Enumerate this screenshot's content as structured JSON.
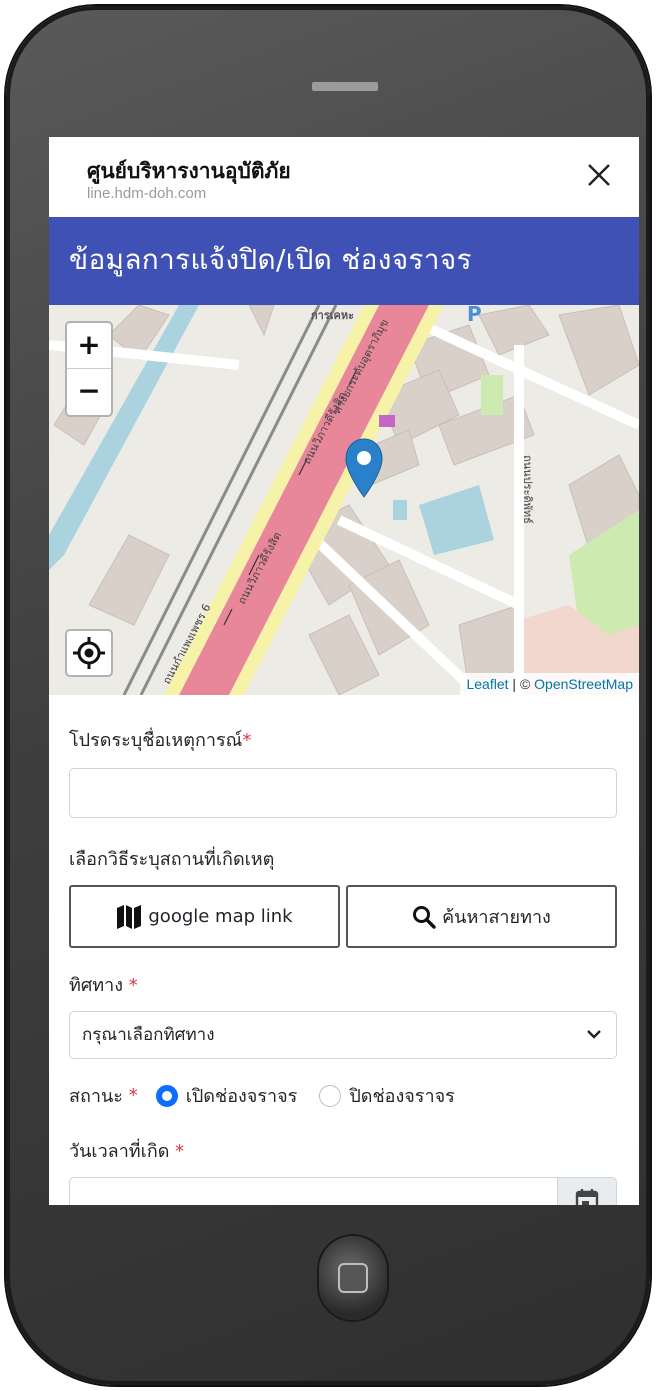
{
  "browser": {
    "title": "ศูนย์บริหารงานอุบัติภัย",
    "url": "line.hdm-doh.com"
  },
  "page": {
    "header": "ข้อมูลการแจ้งปิด/เปิด ช่องจราจร"
  },
  "map": {
    "zoom_in": "+",
    "zoom_out": "−",
    "attribution_leaflet": "Leaflet",
    "attribution_sep": " | © ",
    "attribution_osm": "OpenStreetMap",
    "labels": {
      "road1": "ถนนวิภาวดีรังสิต",
      "road2": "ถนนกำแพงเพชร 6",
      "road3": "ถนนประดิพัทธ์",
      "road4": "ถนนวิภาวดีรังสิต",
      "top": "การเคหะ",
      "rail": "ทางยกระดับอุตราภิมุข"
    },
    "colors": {
      "highway": "#e8879a",
      "trunk": "#f6f2a8",
      "land": "#ecebe6",
      "building": "#d9d0c9",
      "water": "#aad3df",
      "park": "#cdebb0",
      "marker": "#2a81cb"
    }
  },
  "form": {
    "event_name_label": "โปรดระบุชื่อเหตุการณ์",
    "event_name_value": "",
    "location_method_label": "เลือกวิธีระบุสถานที่เกิดเหตุ",
    "google_map_button": "google map link",
    "search_route_button": "ค้นหาสายทาง",
    "direction_label": "ทิศทาง",
    "direction_selected": "กรุณาเลือกทิศทาง",
    "status_label": "สถานะ",
    "status_open": "เปิดช่องจราจร",
    "status_close": "ปิดช่องจราจร",
    "datetime_label": "วันเวลาที่เกิด",
    "datetime_value": "",
    "required_mark": "*"
  }
}
